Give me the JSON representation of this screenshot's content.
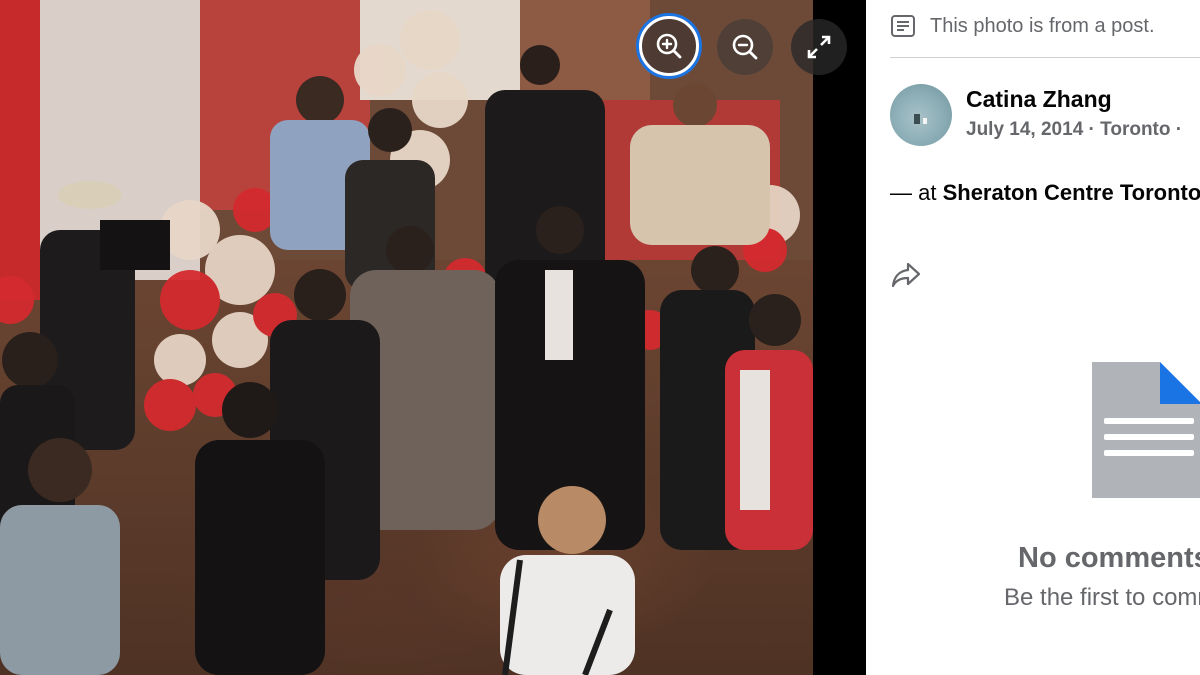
{
  "viewer": {
    "photo_alt": "Event photo",
    "controls": {
      "zoom_in_icon": "zoom-in-icon",
      "zoom_out_icon": "zoom-out-icon",
      "fullscreen_icon": "expand-icon"
    }
  },
  "panel": {
    "notice_icon": "post-text-icon",
    "notice_text": "This photo is from a post.",
    "author_name": "Catina Zhang",
    "meta_text": "July 14, 2014 · Toronto ·",
    "location_prefix": "— at ",
    "location_name": "Sheraton Centre Toronto",
    "share_icon": "share-icon",
    "empty_state": {
      "title": "No comments",
      "subtitle": "Be the first to comment."
    }
  },
  "colors": {
    "focus_ring": "#1b74e4",
    "doc_gray": "#b0b3b8",
    "doc_fold": "#1b74e4",
    "muted_text": "#65676b"
  }
}
